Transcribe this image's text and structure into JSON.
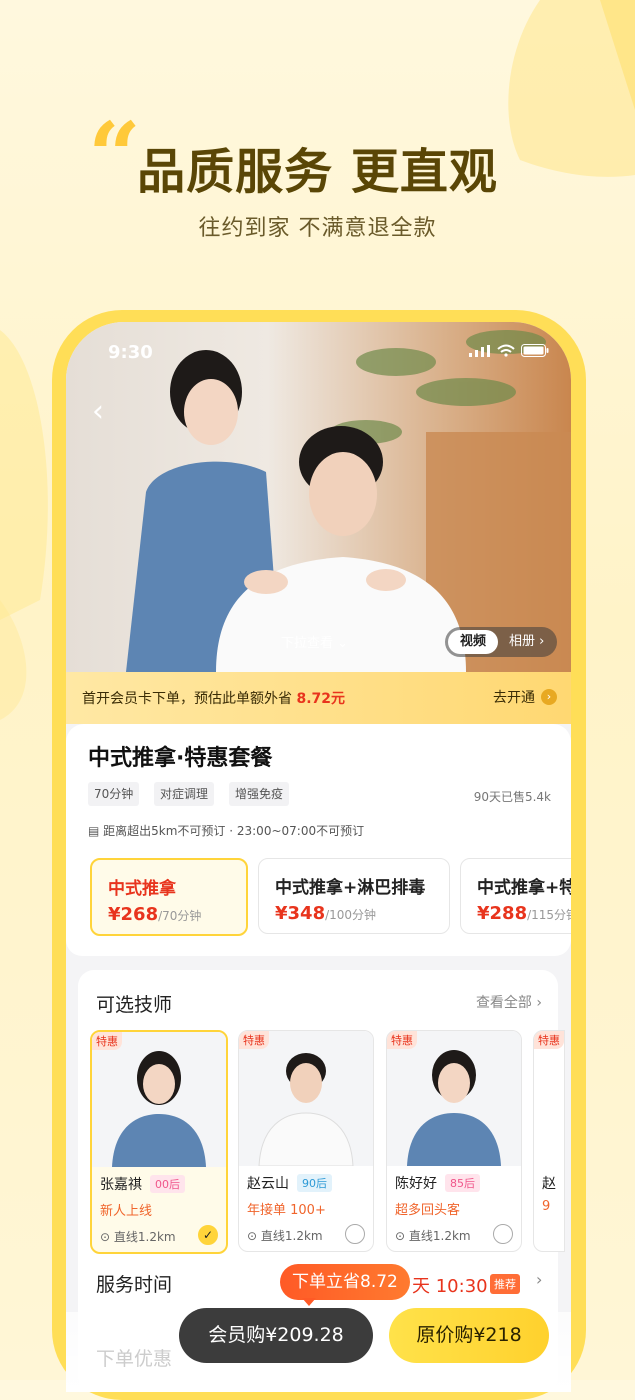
{
  "hero": {
    "quote_mark": "“",
    "title": "品质服务 更直观",
    "subtitle": "往约到家 不满意退全款"
  },
  "status": {
    "time": "9:30"
  },
  "media": {
    "pull_hint": "下拉查看 ⌄",
    "video_label": "视频",
    "album_label": "相册 ›"
  },
  "promo": {
    "text": "首开会员卡下单，预估此单额外省",
    "amount": "8.72元",
    "action": "去开通",
    "arrow": "›"
  },
  "product": {
    "title": "中式推拿·特惠套餐",
    "tags": [
      "70分钟",
      "对症调理",
      "增强免疫"
    ],
    "sold": "90天已售5.4k",
    "notice": "距离超出5km不可预订 · 23:00~07:00不可预订",
    "packages": [
      {
        "name": "中式推拿",
        "price": "¥268",
        "duration": "/70分钟"
      },
      {
        "name": "中式推拿+淋巴排毒",
        "price": "¥348",
        "duration": "/100分钟"
      },
      {
        "name": "中式推拿+特",
        "price": "¥288",
        "duration": "/115分钟"
      }
    ]
  },
  "technicians": {
    "title": "可选技师",
    "more": "查看全部 ›",
    "badge": "特惠",
    "items": [
      {
        "name": "张嘉祺",
        "age": "00后",
        "stat": "新人上线",
        "distance": "直线1.2km"
      },
      {
        "name": "赵云山",
        "age": "90后",
        "stat": "年接单 100+",
        "distance": "直线1.2km"
      },
      {
        "name": "陈好好",
        "age": "85后",
        "stat": "超多回头客",
        "distance": "直线1.2km"
      },
      {
        "name": "赵",
        "stat": "9"
      }
    ]
  },
  "service_time": {
    "title": "服务时间",
    "value": "天 10:30",
    "recommend": "推荐",
    "arrow": "›"
  },
  "save_bubble": "下单立省8.72",
  "coupon": "下单优惠",
  "footer": {
    "member_buy": "会员购¥209.28",
    "original_buy": "原价购¥218"
  },
  "colors": {
    "accent": "#ffd43a",
    "price": "#e8341d",
    "brand_dark": "#5a4606"
  }
}
